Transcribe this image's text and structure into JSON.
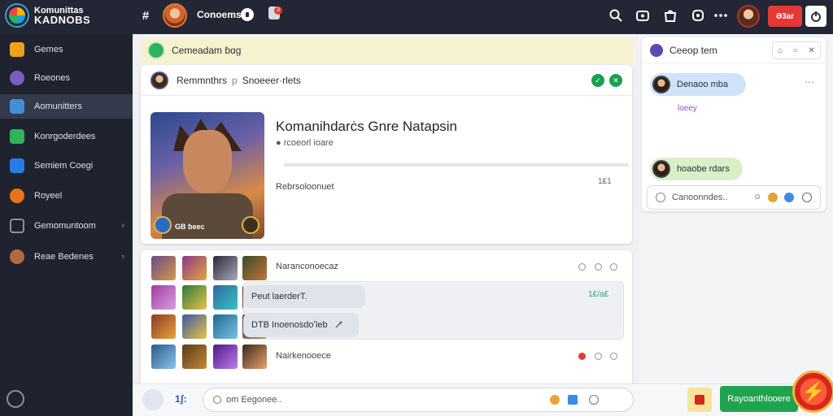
{
  "topbar": {
    "brand_line1": "Komunittas",
    "brand_line2": "KADNOBS",
    "hash_icon": "#",
    "title": "Conoems",
    "badge_count": "3",
    "red_button": "Ə3ar",
    "icons": [
      "search-icon",
      "grid-icon",
      "bag-icon",
      "shield-icon",
      "more-icon"
    ]
  },
  "sidebar": {
    "items": [
      {
        "label": "Gemes",
        "color": "#f0a11a"
      },
      {
        "label": "Roeones",
        "color": "#7a5cc2"
      },
      {
        "label": "Aomunitters",
        "color": "#3f8fd9"
      },
      {
        "label": "Konrgoderdees",
        "color": "#2eb35a"
      },
      {
        "label": "Semiem Coegi",
        "color": "#2a7be4"
      },
      {
        "label": "Royeel",
        "color": "#e8731c"
      },
      {
        "label": "Gemomuntoom",
        "color": "#8a90a3"
      },
      {
        "label": "Reae Bedenes",
        "color": "#b5693a"
      }
    ]
  },
  "main": {
    "banner_text": "Cemeadam  ɓɑg",
    "card": {
      "author": "Remmnthrs",
      "separator": "p",
      "meta": "Snoeeer·rlets",
      "title": "Komanihdarċs Gnre Natapsin",
      "subtitle": "● rcoeorl ioare",
      "hero_label": "GB ɓeec",
      "desc": "Rebrsoloonuet",
      "time": "1₤1",
      "progress": 0.0
    },
    "thread": {
      "row1_label": "Naranconoecaz",
      "bubble1": "Peut  laerderT.",
      "bubble1_time": "1₤/a₤",
      "bubble2": "DTB  Inoenosdoʼleb",
      "row4_label": "Nairkenooece"
    }
  },
  "right_panel": {
    "header": "Ceeop  tem",
    "msg1": "Denaoo mba",
    "msg1_sub": "loeey",
    "msg2": "hoaobe rdars",
    "input_placeholder": "Canoonndes.."
  },
  "bottombar": {
    "count": "1ʃ:",
    "composer_placeholder": "om Eegonee..",
    "green_button": "Rayoanthlooere"
  },
  "colors": {
    "dark_bg": "#232735",
    "sidebar_bg": "#1f232f",
    "accent_green": "#1fa34f",
    "accent_red": "#e53935",
    "pill_blue": "#cfe3fb",
    "pill_green": "#d8f0c8"
  }
}
